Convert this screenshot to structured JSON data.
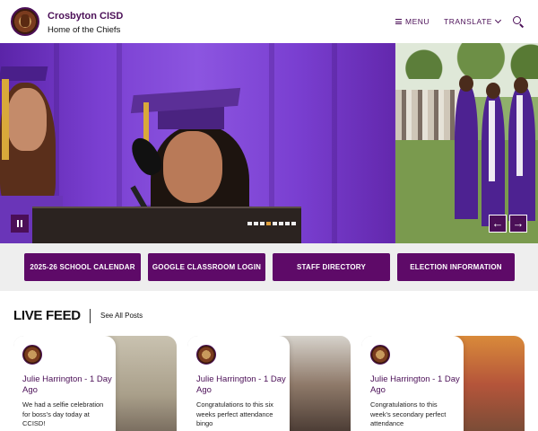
{
  "header": {
    "title": "Crosbyton CISD",
    "subtitle": "Home of the Chiefs",
    "menu_label": "MENU",
    "translate_label": "TRANSLATE"
  },
  "colors": {
    "brand": "#4b0f57",
    "button": "#5e0a68",
    "accent": "#e0a03c"
  },
  "hero": {
    "slide_count": 8,
    "active_slide": 3
  },
  "quick_links": [
    {
      "label": "2025-26 SCHOOL CALENDAR"
    },
    {
      "label": "GOOGLE CLASSROOM LOGIN"
    },
    {
      "label": "STAFF DIRECTORY"
    },
    {
      "label": "ELECTION INFORMATION"
    }
  ],
  "feed": {
    "title": "LIVE FEED",
    "see_all": "See All Posts",
    "posts": [
      {
        "author": "Julie Harrington - 1 Day Ago",
        "text": "We had a selfie celebration for boss's day today at CCISD!"
      },
      {
        "author": "Julie Harrington - 1 Day Ago",
        "text": "Congratulations to this six weeks perfect attendance bingo"
      },
      {
        "author": "Julie Harrington - 1 Day Ago",
        "text": "Congratulations to this week's secondary perfect attendance"
      }
    ]
  },
  "icons": [
    "district-logo-icon",
    "menu-icon",
    "chevron-down-icon",
    "search-icon",
    "pause-icon",
    "arrow-left-icon",
    "arrow-right-icon"
  ]
}
